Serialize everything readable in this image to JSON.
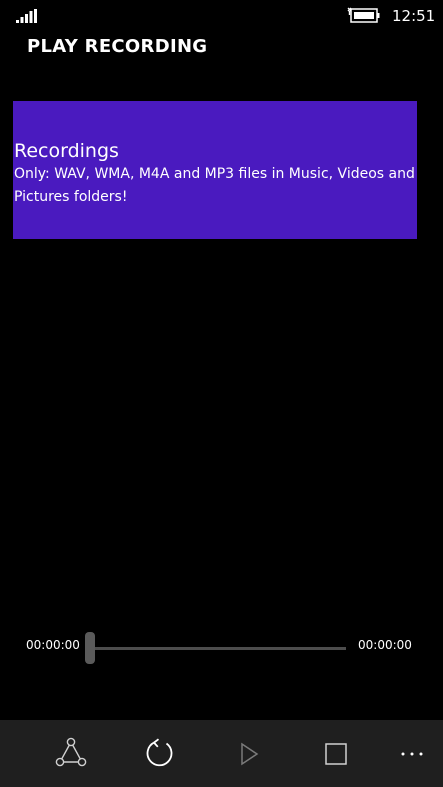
{
  "status_bar": {
    "time": "12:51",
    "signal_icon": "signal-strength-icon",
    "battery_icon": "battery-charging-icon"
  },
  "page": {
    "title": "PLAY RECORDING"
  },
  "recordings_tile": {
    "title": "Recordings",
    "subtitle": "Only: WAV, WMA, M4A and MP3 files in Music, Videos and\nPictures folders!",
    "color": "#4a1abf"
  },
  "player": {
    "current_time": "00:00:00",
    "total_time": "00:00:00",
    "progress": 0
  },
  "app_bar": {
    "background": "#1f1f1f",
    "buttons": [
      {
        "icon": "share-icon"
      },
      {
        "icon": "refresh-icon"
      },
      {
        "icon": "play-icon"
      },
      {
        "icon": "stop-icon"
      },
      {
        "icon": "more-icon"
      }
    ]
  }
}
